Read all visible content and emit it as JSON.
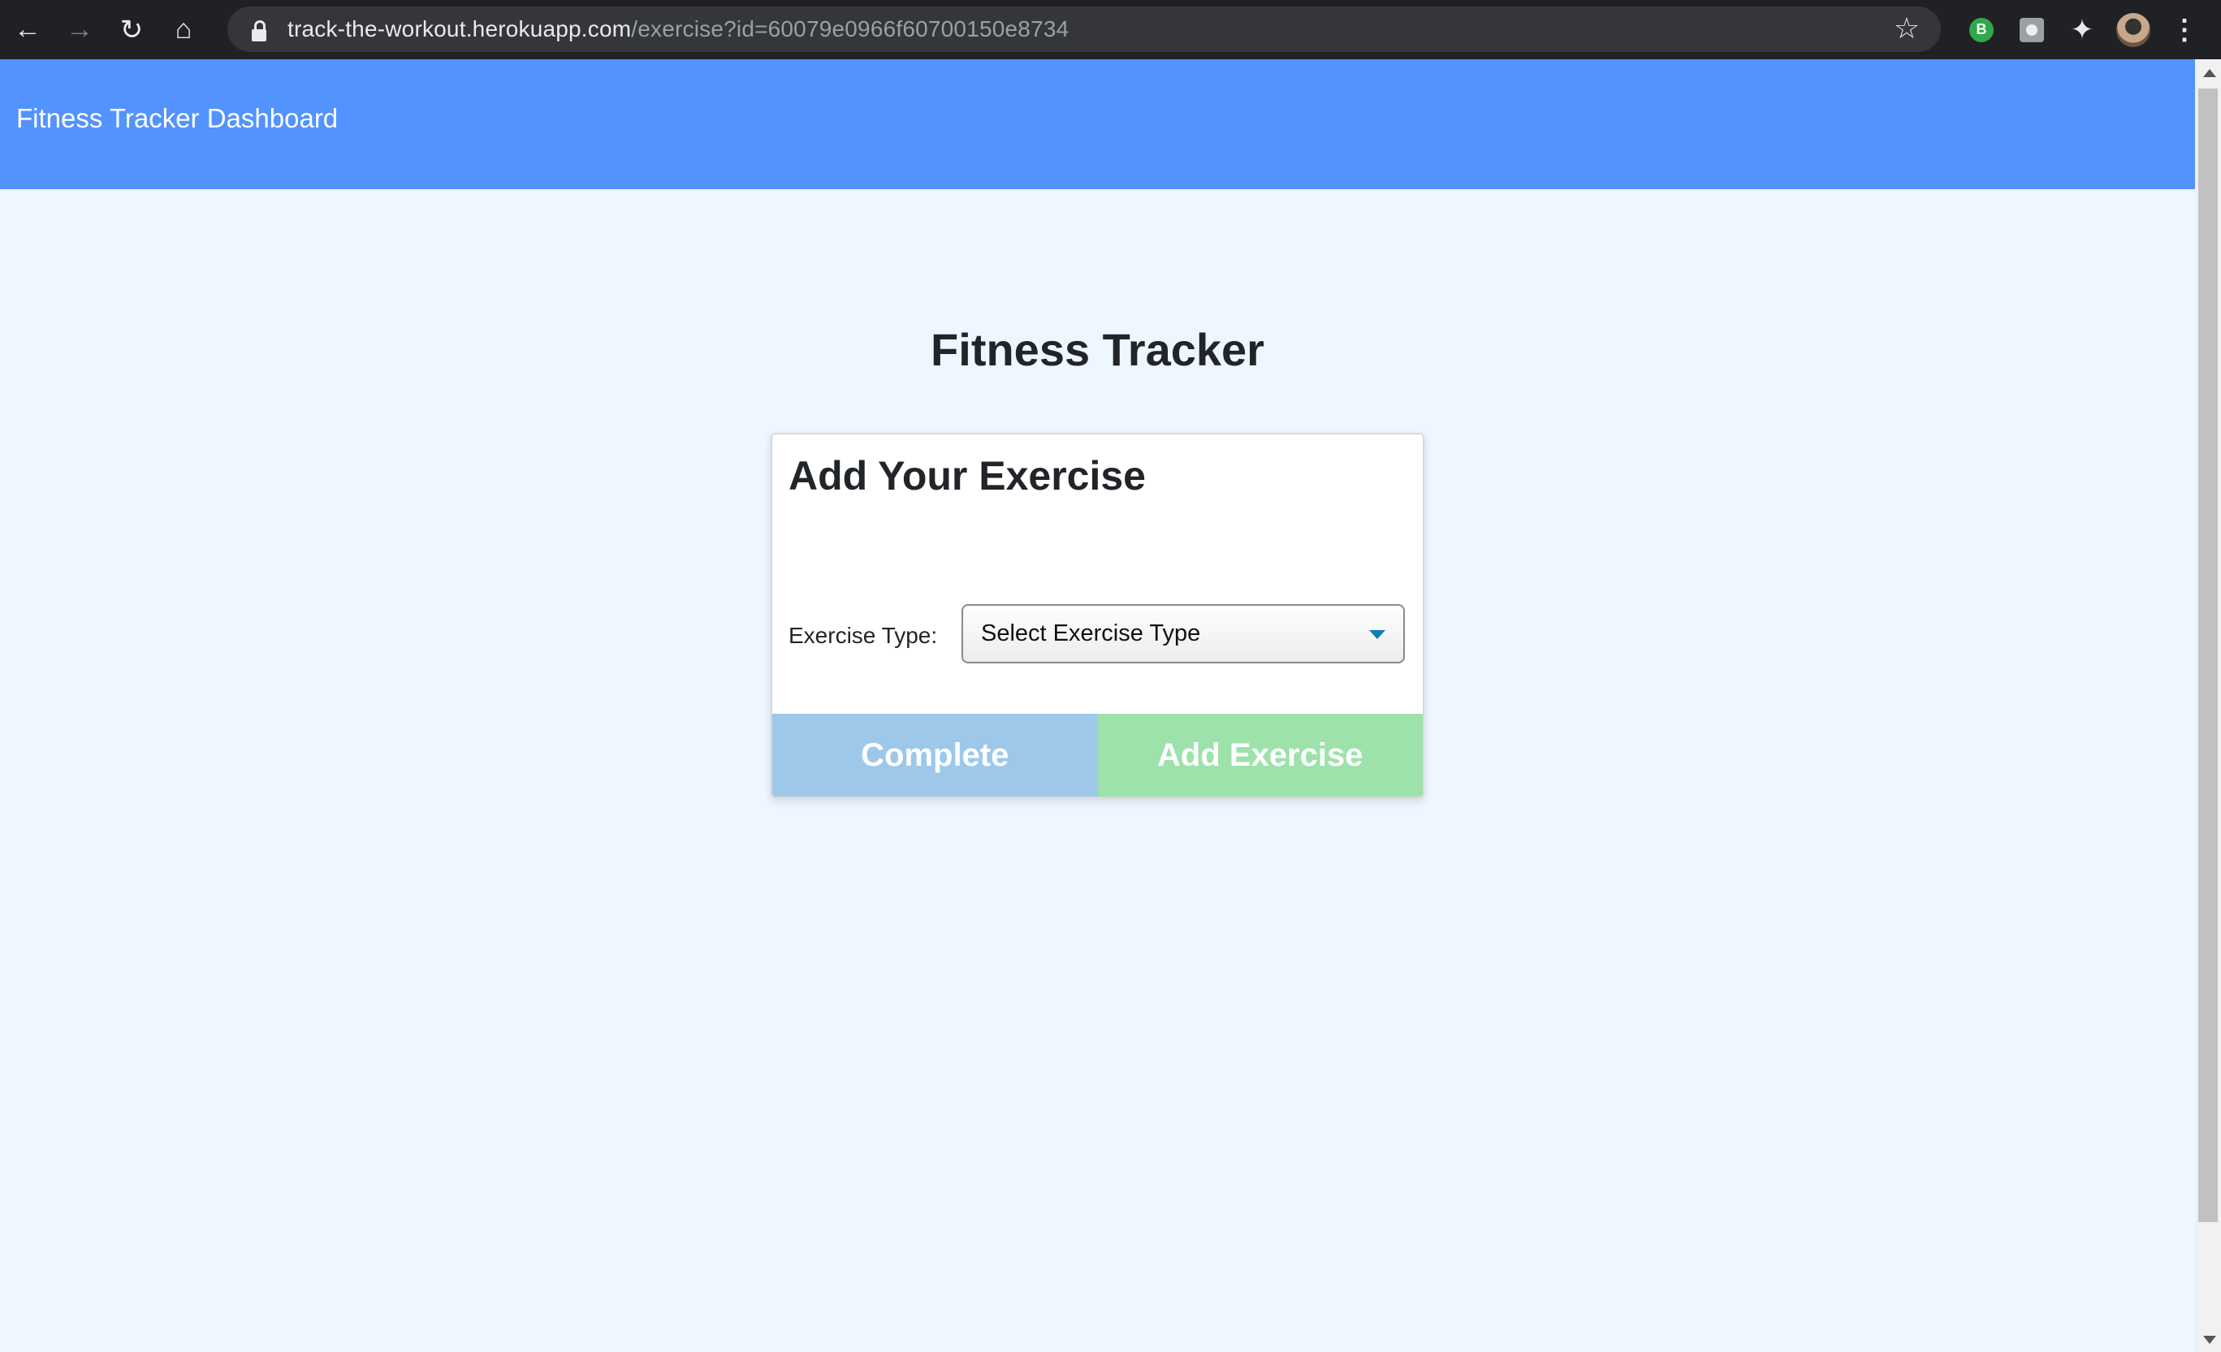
{
  "browser": {
    "url_host": "track-the-workout.herokuapp.com",
    "url_rest": "/exercise?id=60079e0966f60700150e8734",
    "extension_badge": "B",
    "icons": [
      "back-icon",
      "forward-icon",
      "reload-icon",
      "home-icon",
      "lock-icon",
      "star-icon",
      "puzzle-icon",
      "avatar",
      "kebab-menu-icon"
    ]
  },
  "navbar": {
    "brand": "Fitness Tracker Dashboard",
    "color": "#5293fe"
  },
  "main": {
    "title": "Fitness Tracker",
    "card": {
      "title": "Add Your Exercise",
      "exercise_type_label": "Exercise Type:",
      "exercise_type_select": {
        "selected": "Select Exercise Type"
      },
      "complete_label": "Complete",
      "add_exercise_label": "Add Exercise"
    }
  },
  "colors": {
    "page_background": "#eef6ff",
    "complete_button": "#9dc8ea",
    "add_exercise_button": "#9de2ab"
  }
}
